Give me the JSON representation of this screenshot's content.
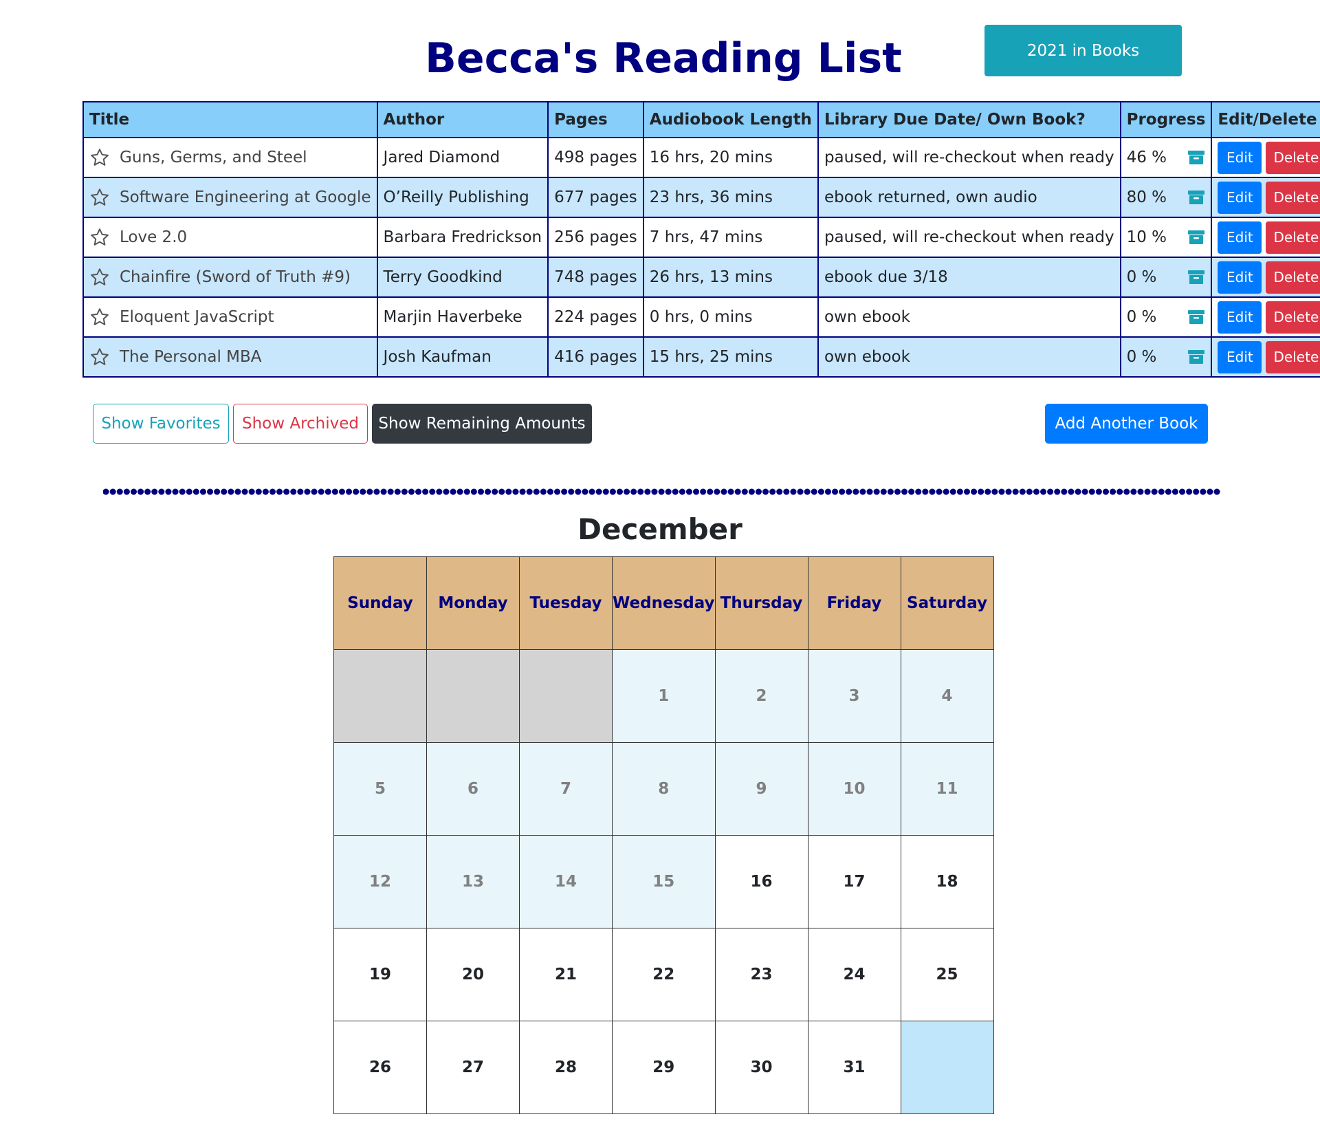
{
  "header": {
    "title": "Becca's Reading List",
    "year_button": "2021 in Books"
  },
  "table": {
    "columns": [
      "Title",
      "Author",
      "Pages",
      "Audiobook Length",
      "Library Due Date/ Own Book?",
      "Progress",
      "Edit/Delete"
    ],
    "edit_label": "Edit",
    "delete_label": "Delete",
    "rows": [
      {
        "title": "Guns, Germs, and Steel",
        "author": "Jared Diamond",
        "pages": "498 pages",
        "audio": "16 hrs, 20 mins",
        "status": "paused, will re-checkout when ready",
        "progress": "46 %"
      },
      {
        "title": "Software Engineering at Google",
        "author": "O’Reilly Publishing",
        "pages": "677 pages",
        "audio": "23 hrs, 36 mins",
        "status": "ebook returned, own audio",
        "progress": "80 %"
      },
      {
        "title": "Love 2.0",
        "author": "Barbara Fredrickson",
        "pages": "256 pages",
        "audio": "7 hrs, 47 mins",
        "status": "paused, will re-checkout when ready",
        "progress": "10 %"
      },
      {
        "title": "Chainfire (Sword of Truth #9)",
        "author": "Terry Goodkind",
        "pages": "748 pages",
        "audio": "26 hrs, 13 mins",
        "status": "ebook due 3/18",
        "progress": "0 %"
      },
      {
        "title": "Eloquent JavaScript",
        "author": "Marjin Haverbeke",
        "pages": "224 pages",
        "audio": "0 hrs, 0 mins",
        "status": "own ebook",
        "progress": "0 %"
      },
      {
        "title": "The Personal MBA",
        "author": "Josh Kaufman",
        "pages": "416 pages",
        "audio": "15 hrs, 25 mins",
        "status": "own ebook",
        "progress": "0 %"
      }
    ]
  },
  "actions": {
    "show_favorites": "Show Favorites",
    "show_archived": "Show Archived",
    "show_remaining": "Show Remaining Amounts",
    "add_book": "Add Another Book"
  },
  "calendar": {
    "month": "December",
    "weekdays": [
      "Sunday",
      "Monday",
      "Tuesday",
      "Wednesday",
      "Thursday",
      "Friday",
      "Saturday"
    ],
    "weeks": [
      [
        {
          "d": "",
          "s": "empty"
        },
        {
          "d": "",
          "s": "empty"
        },
        {
          "d": "",
          "s": "empty"
        },
        {
          "d": "1",
          "s": "past"
        },
        {
          "d": "2",
          "s": "past"
        },
        {
          "d": "3",
          "s": "past"
        },
        {
          "d": "4",
          "s": "past"
        }
      ],
      [
        {
          "d": "5",
          "s": "past"
        },
        {
          "d": "6",
          "s": "past"
        },
        {
          "d": "7",
          "s": "past"
        },
        {
          "d": "8",
          "s": "past"
        },
        {
          "d": "9",
          "s": "past"
        },
        {
          "d": "10",
          "s": "past"
        },
        {
          "d": "11",
          "s": "past"
        }
      ],
      [
        {
          "d": "12",
          "s": "past"
        },
        {
          "d": "13",
          "s": "past"
        },
        {
          "d": "14",
          "s": "past"
        },
        {
          "d": "15",
          "s": "past"
        },
        {
          "d": "16",
          "s": "future"
        },
        {
          "d": "17",
          "s": "future"
        },
        {
          "d": "18",
          "s": "future"
        }
      ],
      [
        {
          "d": "19",
          "s": "future"
        },
        {
          "d": "20",
          "s": "future"
        },
        {
          "d": "21",
          "s": "future"
        },
        {
          "d": "22",
          "s": "future"
        },
        {
          "d": "23",
          "s": "future"
        },
        {
          "d": "24",
          "s": "future"
        },
        {
          "d": "25",
          "s": "future"
        }
      ],
      [
        {
          "d": "26",
          "s": "future"
        },
        {
          "d": "27",
          "s": "future"
        },
        {
          "d": "28",
          "s": "future"
        },
        {
          "d": "29",
          "s": "future"
        },
        {
          "d": "30",
          "s": "future"
        },
        {
          "d": "31",
          "s": "future"
        },
        {
          "d": "",
          "s": "filler"
        }
      ]
    ]
  },
  "colors": {
    "title_navy": "#000080",
    "header_row": "#87cefa",
    "alt_row": "#c8e6fc",
    "weekday_header": "#deb887",
    "past_day": "#e8f6fc",
    "empty_day": "#d3d3d3"
  },
  "icons": {
    "title_decoration": "books-icon",
    "favorite": "star-outline-icon",
    "archive": "archive-box-icon",
    "divider": "dotted-divider"
  }
}
